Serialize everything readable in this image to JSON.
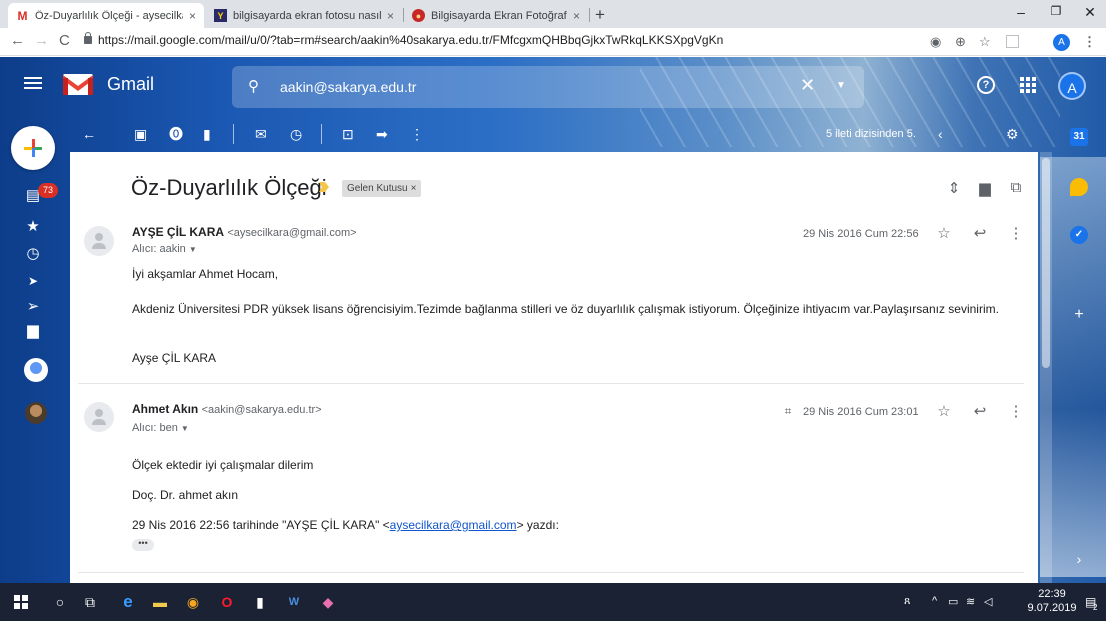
{
  "browser": {
    "tabs": [
      {
        "title": "Öz-Duyarlılık Ölçeği - aysecilkara",
        "favicon": "gmail-icon",
        "active": true
      },
      {
        "title": "bilgisayarda ekran fotosu nasıl al",
        "favicon": "yandex-icon",
        "active": false
      },
      {
        "title": "Bilgisayarda Ekran Fotoğrafı Nası",
        "favicon": "site-icon",
        "active": false
      }
    ],
    "url": "https://mail.google.com/mail/u/0/?tab=rm#search/aakin%40sakarya.edu.tr/FMfcgxmQHBbqGjkxTwRkqLKKSXpgVgKn",
    "profile_initial": "A"
  },
  "gmail": {
    "brand": "Gmail",
    "search_value": "aakin@sakarya.edu.tr",
    "account_initial": "A",
    "unread_badge": "73",
    "pager": "5 ileti dizisinden 5.",
    "calendar_day": "31"
  },
  "thread": {
    "subject": "Öz-Duyarlılık Ölçeği",
    "label": "Gelen Kutusu",
    "label_close": "×",
    "messages": [
      {
        "sender": "AYŞE ÇİL KARA",
        "address": "<aysecilkara@gmail.com>",
        "to": "Alıcı: aakin",
        "date": "29 Nis 2016 Cum 22:56",
        "body": [
          "İyi akşamlar Ahmet Hocam,",
          "Akdeniz Üniversitesi PDR yüksek lisans öğrencisiyim.Tezimde bağlanma stilleri ve öz duyarlılık çalışmak istiyorum. Ölçeğinize ihtiyacım var.Paylaşırsanız sevinirim.",
          "Ayşe ÇİL KARA"
        ]
      },
      {
        "sender": "Ahmet Akın",
        "address": "<aakin@sakarya.edu.tr>",
        "to": "Alıcı: ben",
        "date": "29 Nis 2016 Cum 23:01",
        "body": [
          "Ölçek ektedir iyi çalışmalar dilerim",
          "Doç. Dr. ahmet akın"
        ],
        "quote_prefix": "29 Nis 2016 22:56 tarihinde \"AYŞE ÇİL KARA\" <",
        "quote_link": "aysecilkara@gmail.com",
        "quote_suffix": "> yazdı:",
        "ellipsis": "•••"
      }
    ]
  },
  "taskbar": {
    "time": "22:39",
    "date": "9.07.2019",
    "notifications": "2"
  }
}
